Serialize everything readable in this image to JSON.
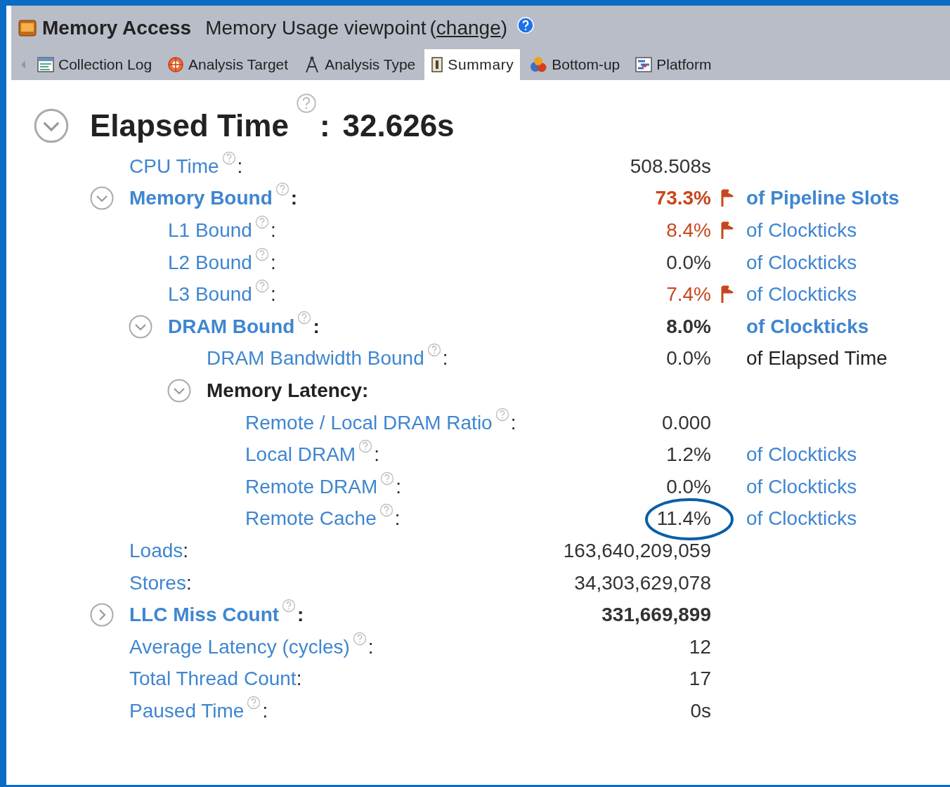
{
  "header": {
    "analysis": "Memory Access",
    "viewpoint": "Memory Usage viewpoint",
    "change_brackets": [
      "(",
      ")"
    ],
    "change_link": "change"
  },
  "tabs": [
    {
      "label": "Collection Log",
      "kind": "log",
      "selected": false
    },
    {
      "label": "Analysis Target",
      "kind": "target",
      "selected": false
    },
    {
      "label": "Analysis Type",
      "kind": "type",
      "selected": false
    },
    {
      "label": "Summary",
      "kind": "summary",
      "selected": true
    },
    {
      "label": "Bottom-up",
      "kind": "bottomup",
      "selected": false
    },
    {
      "label": "Platform",
      "kind": "platform",
      "selected": false
    }
  ],
  "summary": {
    "title": "Elapsed Time",
    "separator": ":",
    "value": "32.626s",
    "expanded": true,
    "metrics": [
      {
        "label": "CPU Time",
        "suffix": ":",
        "help": true,
        "value": "508.508s"
      },
      {
        "label": "Memory Bound",
        "suffix": ":",
        "help": true,
        "bold": true,
        "expanded": true,
        "value": "73.3%",
        "flagged": true,
        "unit": "of Pipeline Slots",
        "children": [
          {
            "label": "L1 Bound",
            "suffix": ":",
            "help": true,
            "value": "8.4%",
            "flagged": true,
            "unit": "of Clockticks"
          },
          {
            "label": "L2 Bound",
            "suffix": ":",
            "help": true,
            "value": "0.0%",
            "flagged": false,
            "unit": "of Clockticks"
          },
          {
            "label": "L3 Bound",
            "suffix": ":",
            "help": true,
            "value": "7.4%",
            "flagged": true,
            "unit": "of Clockticks"
          },
          {
            "label": "DRAM Bound",
            "suffix": ":",
            "help": true,
            "bold": true,
            "expanded": true,
            "value": "8.0%",
            "flagged": false,
            "unit": "of Clockticks",
            "children": [
              {
                "label": "DRAM Bandwidth Bound",
                "suffix": ":",
                "help": true,
                "value": "0.0%",
                "flagged": false,
                "unit": "of Elapsed Time",
                "unit_link": false
              },
              {
                "label": "Memory Latency:",
                "plain": true,
                "bold": true,
                "expanded": true,
                "children": [
                  {
                    "label": "Remote / Local DRAM Ratio",
                    "suffix": ":",
                    "help": true,
                    "value": "0.000"
                  },
                  {
                    "label": "Local DRAM",
                    "suffix": ":",
                    "help": true,
                    "value": "1.2%",
                    "unit": "of Clockticks"
                  },
                  {
                    "label": "Remote DRAM",
                    "suffix": ":",
                    "help": true,
                    "value": "0.0%",
                    "unit": "of Clockticks"
                  },
                  {
                    "label": "Remote Cache",
                    "suffix": ":",
                    "help": true,
                    "value": "11.4%",
                    "unit": "of Clockticks",
                    "circled": true
                  }
                ]
              }
            ]
          }
        ]
      },
      {
        "label": "Loads",
        "suffix": ":",
        "help": false,
        "value": "163,640,209,059"
      },
      {
        "label": "Stores",
        "suffix": ":",
        "help": false,
        "value": "34,303,629,078"
      },
      {
        "label": "LLC Miss Count",
        "suffix": ":",
        "help": true,
        "bold": true,
        "expanded": false,
        "value": "331,669,899"
      },
      {
        "label": "Average Latency (cycles)",
        "suffix": ":",
        "help": true,
        "value": "12"
      },
      {
        "label": "Total Thread Count",
        "suffix": ":",
        "help": false,
        "value": "17"
      },
      {
        "label": "Paused Time",
        "suffix": ":",
        "help": true,
        "value": "0s"
      }
    ]
  }
}
